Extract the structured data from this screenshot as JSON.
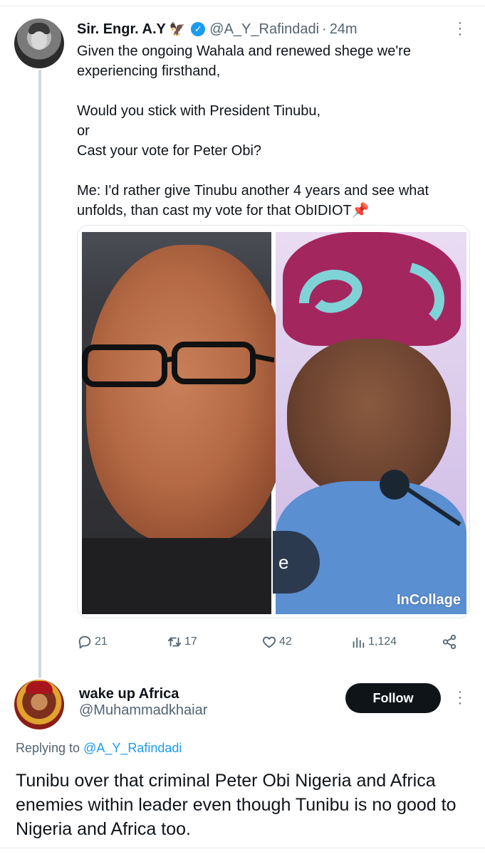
{
  "tweet": {
    "author_name": "Sir. Engr. A.Y",
    "author_emoji": "🦅",
    "handle": "@A_Y_Rafindadi",
    "separator": "·",
    "time": "24m",
    "paragraphs": [
      "Given the ongoing Wahala and renewed shege we're experiencing firsthand,",
      "Would you stick with President Tinubu,\nor\nCast your vote for Peter Obi?",
      "Me: I'd rather give Tinubu another 4 years  and see what unfolds, than cast my vote for that ObIDIOT📌"
    ],
    "media_watermark": "InCollage",
    "media_overlay_letter": "e",
    "actions": {
      "replies": "21",
      "retweets": "17",
      "likes": "42",
      "views": "1,124"
    },
    "icons": {
      "more": "more-vertical-icon",
      "verified": "verified-badge-icon",
      "reply": "reply-icon",
      "retweet": "retweet-icon",
      "like": "heart-icon",
      "views": "views-chart-icon",
      "share": "share-icon"
    }
  },
  "reply": {
    "author_name": "wake up Africa",
    "handle": "@Muhammadkhaiar",
    "follow_label": "Follow",
    "replying_prefix": "Replying to ",
    "replying_handle": "@A_Y_Rafindadi",
    "text": "Tunibu over that criminal Peter Obi Nigeria and Africa enemies within leader even though Tunibu is no good to Nigeria and Africa too."
  },
  "colors": {
    "text": "#0f1419",
    "secondary": "#536471",
    "accent": "#1d9bf0",
    "follow_button": "#0f1419",
    "divider": "#e7e9ea",
    "thread_line": "#cfd9de"
  }
}
